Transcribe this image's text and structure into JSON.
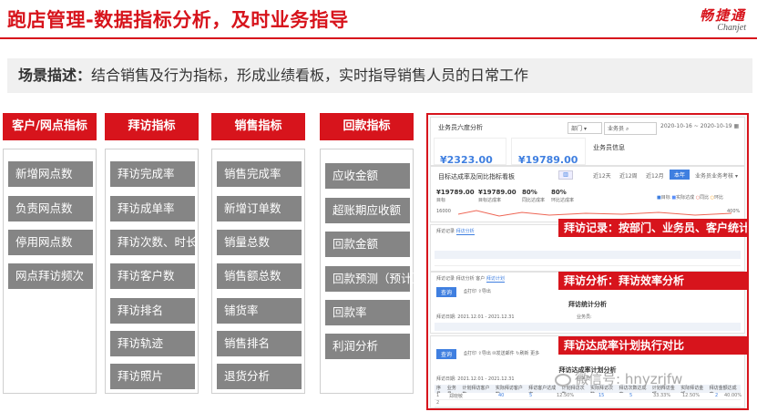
{
  "title": "跑店管理-数据指标分析，及时业务指导",
  "logo": {
    "cn": "畅捷通",
    "en": "Chanjet"
  },
  "scene": {
    "label": "场景描述：",
    "text": "结合销售及行为指标，形成业绩看板，实时指导销售人员的日常工作"
  },
  "columns": [
    {
      "head": "客户/网点指标",
      "items": [
        "新增网点数",
        "负责网点数",
        "停用网点数",
        "网点拜访频次"
      ]
    },
    {
      "head": "拜访指标",
      "items": [
        "拜访完成率",
        "拜访成单率",
        "拜访次数、时长",
        "拜访客户数",
        "拜访排名",
        "拜访轨迹",
        "拜访照片"
      ]
    },
    {
      "head": "销售指标",
      "items": [
        "销售完成率",
        "新增订单数",
        "销量总数",
        "销售额总数",
        "铺货率",
        "销售排名",
        "退货分析"
      ]
    },
    {
      "head": "回款指标",
      "items": [
        "应收金额",
        "超账期应收额",
        "回款金额",
        "回款预测（预计）",
        "回款率",
        "利润分析"
      ]
    }
  ],
  "screenshot": {
    "ss1": {
      "title": "业务员六度分析",
      "dept": "部门",
      "staff": "业务员",
      "range": "2020-10-16 ~ 2020-10-19",
      "amount1": "¥2323.00",
      "amount2": "¥19789.00",
      "info": "业务员信息"
    },
    "ss2": {
      "title": "目标达成率及同比指标看板",
      "tabs": [
        "近12天",
        "近12周",
        "近12月",
        "本年",
        "业务员业务考核"
      ],
      "v1": "¥19789.00",
      "v2": "¥19789.00",
      "v3": "80%",
      "v4": "80%",
      "l1": "目标",
      "l2": "目标达成率",
      "l3": "同比达成率",
      "l4": "环比达成率",
      "axis": "16000",
      "pct": "400%",
      "legend": [
        "目标",
        "实际达成",
        "同比",
        "环比"
      ]
    },
    "ss3": {
      "title": "拜访统计分析",
      "tabs": [
        "拜访记录",
        "拜访分析",
        "拜访计划",
        "客户"
      ],
      "query": "查询",
      "print": "打印",
      "export": "导出",
      "daterange": "拜访日期: 2021.12.01 - 2021.12.31",
      "staff": "业务员:"
    },
    "ss4": {
      "title": "拜访达成率计划分析",
      "query": "查询",
      "print": "打印",
      "export": "导出",
      "send": "发送邮件",
      "refresh": "刷新",
      "more": "更多",
      "daterange": "拜访日期: 2021.12.01 - 2021.12.31",
      "staff": "业务员:",
      "headers": [
        "序号",
        "业务员",
        "计划拜访客户数",
        "实际拜访客户数",
        "拜访客户达成率",
        "计划拜访次数",
        "实际拜访次数",
        "拜访次数达成率",
        "计划拜访金额",
        "实际拜访金额",
        "拜访金额达成率"
      ],
      "row1": [
        "1",
        "郑晓敏",
        "40",
        "5",
        "12.50%",
        "15",
        "5",
        "33.33%",
        "12.50%",
        "2",
        "40.00%"
      ],
      "row2": [
        "2"
      ]
    }
  },
  "callouts": [
    "拜访记录：按部门、业务员、客户统计",
    "拜访分析：拜访效率分析",
    "拜访达成率计划执行对比"
  ],
  "watermark": "微信号: hnyzrjfw",
  "colors": {
    "brand": "#d7141c",
    "item": "#858585",
    "accent": "#3f7fe0"
  }
}
